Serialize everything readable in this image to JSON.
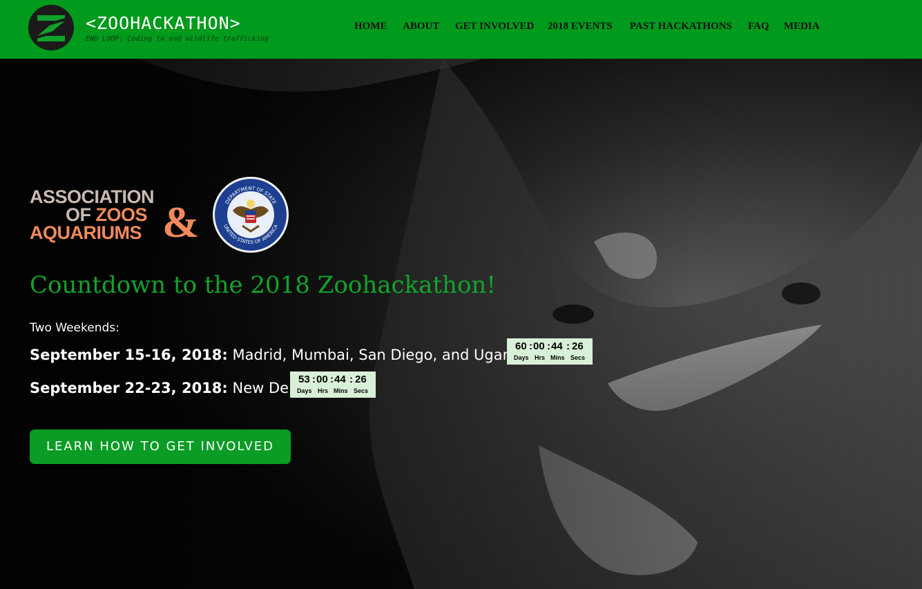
{
  "header": {
    "logo_title": "<ZOOHACKATHON>",
    "tagline": "END LOOP: Coding to end wildlife trafficking",
    "nav": [
      "HOME",
      "ABOUT",
      "GET INVOLVED",
      "2018 EVENTS",
      "PAST HACKATHONS",
      "FAQ",
      "MEDIA"
    ]
  },
  "sponsors": {
    "aza": {
      "line1": "ASSOCIATION",
      "line2a": "OF ",
      "line2b": "ZOOS",
      "line3": "AQUARIUMS",
      "amp": "&"
    },
    "seal": {
      "top_text": "DEPARTMENT OF STATE",
      "bottom_text": "UNITED STATES OF AMERICA"
    }
  },
  "main": {
    "title": "Countdown to the 2018 Zoohackathon!",
    "intro": "Two Weekends:",
    "events": [
      {
        "dates": "September 15-16, 2018:",
        "places": "Madrid, Mumbai, San Diego, and Uganda",
        "timer": {
          "days": "60",
          "hrs": "00",
          "mins": "44",
          "secs": "26"
        }
      },
      {
        "dates": "September 22-23, 2018:",
        "places": "New Delhi",
        "timer": {
          "days": "53",
          "hrs": "00",
          "mins": "44",
          "secs": "26"
        }
      }
    ],
    "timer_labels": {
      "days": "Days",
      "hrs": "Hrs",
      "mins": "Mins",
      "secs": "Secs"
    },
    "separator": ":",
    "cta_label": "LEARN HOW TO GET INVOLVED"
  },
  "colors": {
    "header_bg": "#009a1c",
    "title_green": "#11a52a",
    "button_green": "#0a9c25",
    "timer_bg": "#d8f0d8",
    "aza_tan": "#c9bbb2",
    "aza_coral": "#f08a5d"
  },
  "icons": {
    "logo": "z-circle-logo",
    "seal": "department-of-state-seal"
  }
}
